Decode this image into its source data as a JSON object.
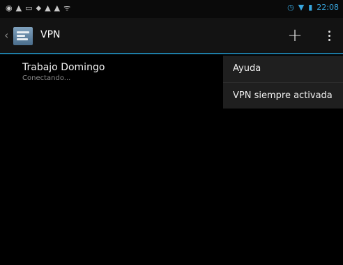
{
  "status_bar": {
    "left_icons": [
      "notification-icon",
      "warning-icon",
      "image-icon",
      "usb-icon",
      "warning-icon",
      "warning-icon",
      "wifi-small-icon"
    ],
    "right_icons": [
      "alarm-icon",
      "wifi-icon",
      "battery-icon"
    ],
    "time": "22:08"
  },
  "action_bar": {
    "title": "VPN",
    "add_icon": "plus-icon",
    "overflow_icon": "overflow-menu-icon"
  },
  "vpn_list": [
    {
      "name": "Trabajo Domingo",
      "status": "Conectando..."
    }
  ],
  "overflow_menu": {
    "items": [
      {
        "label": "Ayuda"
      },
      {
        "label": "VPN siempre activada"
      }
    ]
  },
  "colors": {
    "accent": "#38a6de",
    "actionbar_divider": "#1e7ea8",
    "background": "#000000"
  }
}
